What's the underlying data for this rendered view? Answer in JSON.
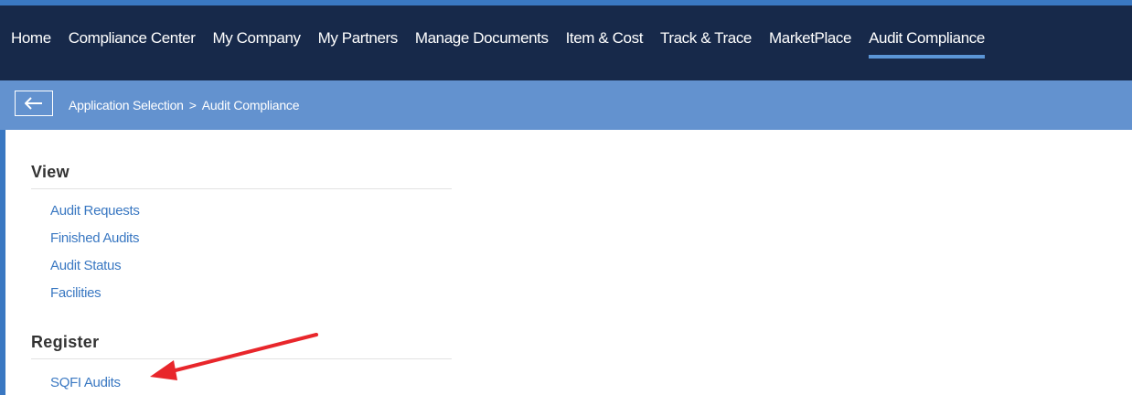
{
  "nav": {
    "items": [
      {
        "label": "Home",
        "name": "nav-item-home"
      },
      {
        "label": "Compliance Center",
        "name": "nav-item-compliance-center"
      },
      {
        "label": "My Company",
        "name": "nav-item-my-company"
      },
      {
        "label": "My Partners",
        "name": "nav-item-my-partners"
      },
      {
        "label": "Manage Documents",
        "name": "nav-item-manage-documents"
      },
      {
        "label": "Item & Cost",
        "name": "nav-item-item-cost"
      },
      {
        "label": "Track & Trace",
        "name": "nav-item-track-trace"
      },
      {
        "label": "MarketPlace",
        "name": "nav-item-marketplace"
      },
      {
        "label": "Audit Compliance",
        "name": "nav-item-audit-compliance",
        "active": true
      }
    ]
  },
  "breadcrumb": {
    "root": "Application Selection",
    "separator": ">",
    "current": "Audit Compliance"
  },
  "view": {
    "title": "View",
    "links": [
      "Audit Requests",
      "Finished Audits",
      "Audit Status",
      "Facilities"
    ]
  },
  "register": {
    "title": "Register",
    "links": [
      "SQFI Audits"
    ]
  },
  "colors": {
    "nav_bg": "#17294a",
    "breadcrumb_bg": "#6392cf",
    "link": "#3a78c2",
    "annotation_arrow": "#e8262b"
  },
  "icons": {
    "back": "arrow-left-icon",
    "annotation": "red-arrow-annotation"
  }
}
